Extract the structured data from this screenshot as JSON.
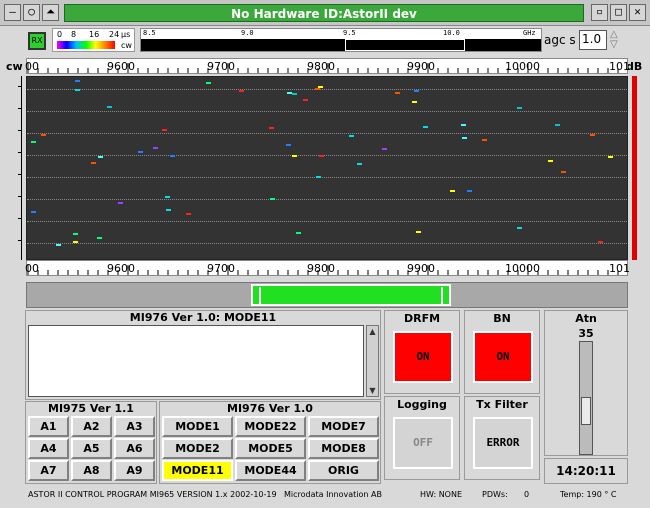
{
  "window": {
    "title": "No Hardware   ID:AstorII dev",
    "controls_left": [
      "—",
      "○",
      "⏶"
    ],
    "controls_right": [
      "▫",
      "□",
      "✕"
    ]
  },
  "top": {
    "rx_label": "RX",
    "pulse_scale": {
      "ticks": [
        "0",
        "8",
        "16",
        "24"
      ],
      "unit": "µs",
      "mode": "cw"
    },
    "ghz_scale": {
      "ticks": [
        "8.5",
        "9.0",
        "9.5",
        "10.0"
      ],
      "unit": "GHz"
    },
    "agc_label": "agc s",
    "agc_value": "1.0"
  },
  "spectrum": {
    "left_label": "cw",
    "right_label": "dB",
    "top_ruler": [
      "00",
      "9600",
      "9700",
      "9800",
      "9900",
      "10000",
      "101"
    ],
    "bottom_ruler": [
      "00",
      "9600",
      "9700",
      "9800",
      "9900",
      "10000",
      "101"
    ]
  },
  "mi976_log": {
    "title": "MI976 Ver 1.0: MODE11",
    "text": ""
  },
  "drfm": {
    "title": "DRFM",
    "button": "ON"
  },
  "bn": {
    "title": "BN",
    "button": "ON"
  },
  "logging": {
    "title": "Logging",
    "button": "OFF"
  },
  "tx_filter": {
    "title": "Tx Filter",
    "button": "ERROR"
  },
  "atn": {
    "title": "Atn",
    "value": 35,
    "value_text": "35",
    "level_fraction": 0.35
  },
  "clock": "14:20:11",
  "mi975": {
    "title": "MI975 Ver 1.1",
    "buttons": [
      "A1",
      "A2",
      "A3",
      "A4",
      "A5",
      "A6",
      "A7",
      "A8",
      "A9"
    ]
  },
  "mi976_modes": {
    "title": "MI976 Ver 1.0",
    "buttons": [
      "MODE1",
      "MODE22",
      "MODE7",
      "MODE2",
      "MODE5",
      "MODE8",
      "MODE11",
      "MODE44",
      "ORIG"
    ],
    "active": "MODE11"
  },
  "status": {
    "program": "ASTOR II CONTROL PROGRAM MI965 VERSION 1.x  2002-10-19",
    "company": "Microdata Innovation AB",
    "hw": "HW: NONE",
    "pdws_label": "PDWs:",
    "pdws_value": "0",
    "temp": "Temp: 190   ° C"
  },
  "colors": {
    "title_bar": "#3aa83a",
    "active_button": "#ffff00",
    "on_button": "#ff0000",
    "scroll_thumb": "#21e021",
    "db_bar": "#e00000"
  }
}
